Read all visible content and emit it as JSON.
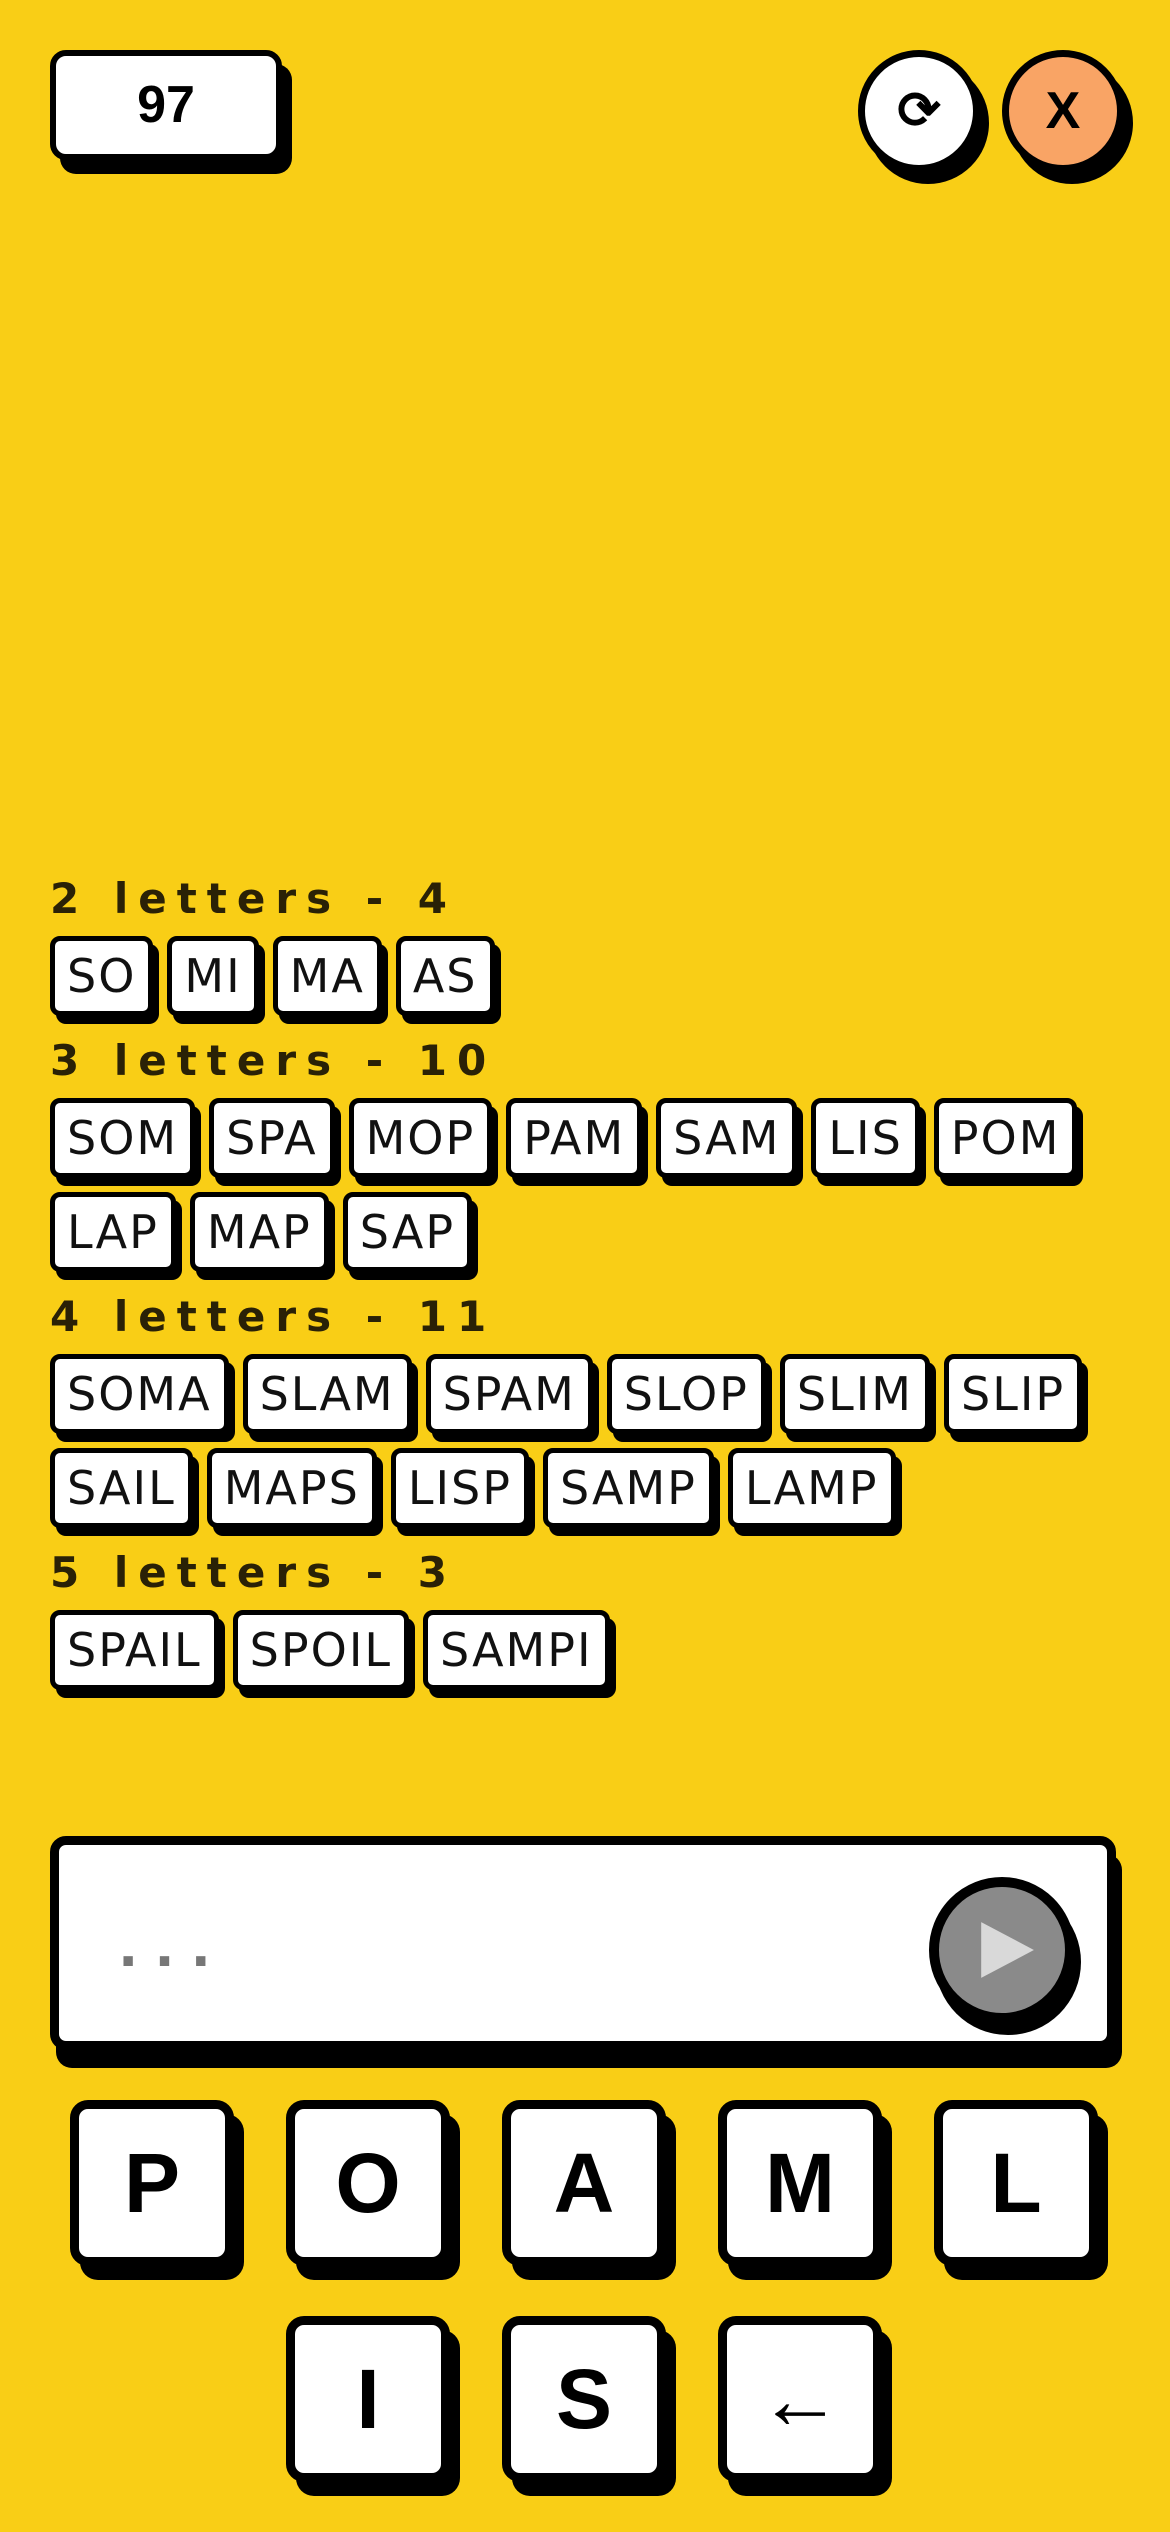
{
  "header": {
    "score": "97",
    "restart_icon": "⟳",
    "close_label": "X"
  },
  "groups": [
    {
      "title": "2 letters - 4",
      "words": [
        "SO",
        "MI",
        "MA",
        "AS"
      ]
    },
    {
      "title": "3 letters - 10",
      "words": [
        "SOM",
        "SPA",
        "MOP",
        "PAM",
        "SAM",
        "LIS",
        "POM",
        "LAP",
        "MAP",
        "SAP"
      ]
    },
    {
      "title": "4 letters - 11",
      "words": [
        "SOMA",
        "SLAM",
        "SPAM",
        "SLOP",
        "SLIM",
        "SLIP",
        "SAIL",
        "MAPS",
        "LISP",
        "SAMP",
        "LAMP"
      ]
    },
    {
      "title": "5 letters - 3",
      "words": [
        "SPAIL",
        "SPOIL",
        "SAMPI"
      ]
    }
  ],
  "input": {
    "value": "...",
    "submit_icon": "play-icon"
  },
  "keyboard": {
    "row1": [
      "P",
      "O",
      "A",
      "M",
      "L"
    ],
    "row2": [
      "I",
      "S",
      "←"
    ]
  },
  "colors": {
    "background": "#F9CE16",
    "close_button": "#F9A465",
    "submit_button": "#8a8a8a"
  }
}
